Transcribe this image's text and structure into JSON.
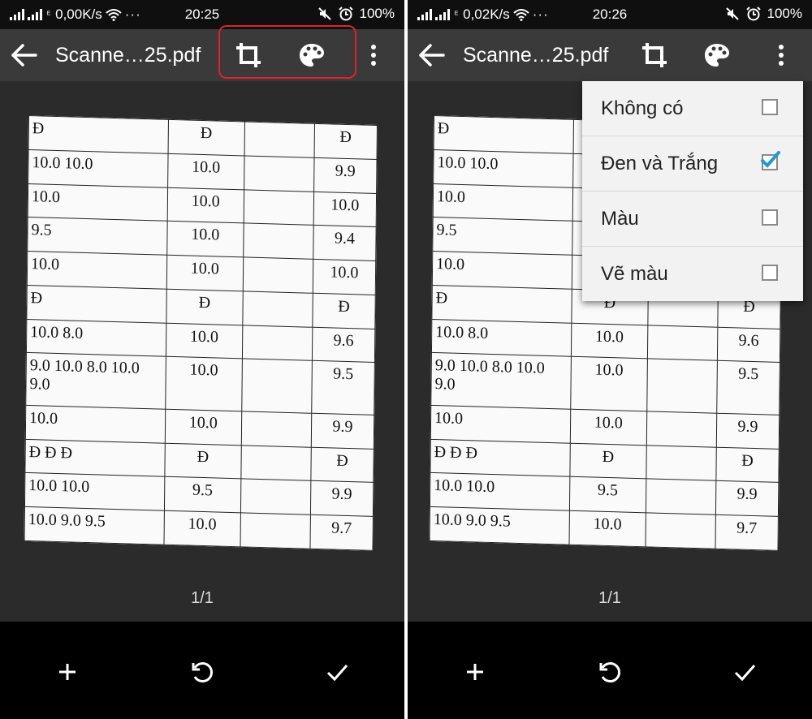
{
  "screens": [
    {
      "status": {
        "net_speed": "0,00K/s",
        "time": "20:25",
        "battery": "100%"
      },
      "toolbar": {
        "title": "Scanne…25.pdf"
      }
    },
    {
      "status": {
        "net_speed": "0,02K/s",
        "time": "20:26",
        "battery": "100%"
      },
      "toolbar": {
        "title": "Scanne…25.pdf"
      }
    }
  ],
  "document": {
    "rows": [
      [
        "Đ",
        "Đ",
        "",
        "Đ"
      ],
      [
        "10.0 10.0",
        "10.0",
        "",
        "9.9"
      ],
      [
        "10.0",
        "10.0",
        "",
        "10.0"
      ],
      [
        "9.5",
        "10.0",
        "",
        "9.4"
      ],
      [
        "10.0",
        "10.0",
        "",
        "10.0"
      ],
      [
        "Đ",
        "Đ",
        "",
        "Đ"
      ],
      [
        "10.0 8.0",
        "10.0",
        "",
        "9.6"
      ],
      [
        "9.0 10.0 8.0 10.0 9.0",
        "10.0",
        "",
        "9.5"
      ],
      [
        "10.0",
        "10.0",
        "",
        "9.9"
      ],
      [
        "Đ Đ Đ",
        "Đ",
        "",
        "Đ"
      ],
      [
        "10.0 10.0",
        "9.5",
        "",
        "9.9"
      ],
      [
        "10.0 9.0 9.5",
        "10.0",
        "",
        "9.7"
      ]
    ]
  },
  "page_indicator": "1/1",
  "menu": {
    "items": [
      {
        "label": "Không có",
        "checked": false
      },
      {
        "label": "Đen và Trắng",
        "checked": true
      },
      {
        "label": "Màu",
        "checked": false
      },
      {
        "label": "Vẽ màu",
        "checked": false
      }
    ]
  },
  "icons": {
    "back": "arrow-left-icon",
    "crop": "crop-icon",
    "palette": "palette-icon",
    "more": "more-vert-icon",
    "add": "plus-icon",
    "rotate": "rotate-icon",
    "confirm": "check-icon"
  },
  "colors": {
    "highlight": "#e0222b",
    "checkbox_accent": "#1e9ad6",
    "toolbar": "#3a3a3a",
    "background": "#2b2b2b",
    "bottom_bar": "#000000"
  }
}
